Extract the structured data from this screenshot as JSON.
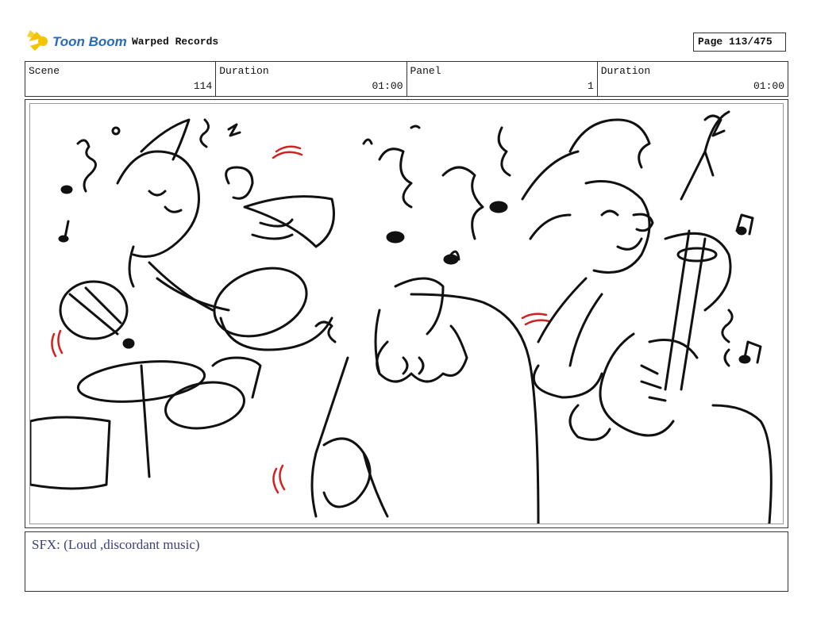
{
  "header": {
    "logo_text": "Toon Boom",
    "project_title": "Warped Records",
    "page_label": "Page 113/475"
  },
  "info": {
    "scene_label": "Scene",
    "scene_value": "114",
    "scene_duration_label": "Duration",
    "scene_duration_value": "01:00",
    "panel_label": "Panel",
    "panel_value": "1",
    "panel_duration_label": "Duration",
    "panel_duration_value": "01:00"
  },
  "caption": {
    "text": "SFX: (Loud ,discordant music)"
  },
  "colors": {
    "logo_yellow": "#f5c400",
    "logo_blue": "#2a6bb8",
    "caption_ink": "#3a3f7a",
    "sketch_red": "#d42020"
  }
}
